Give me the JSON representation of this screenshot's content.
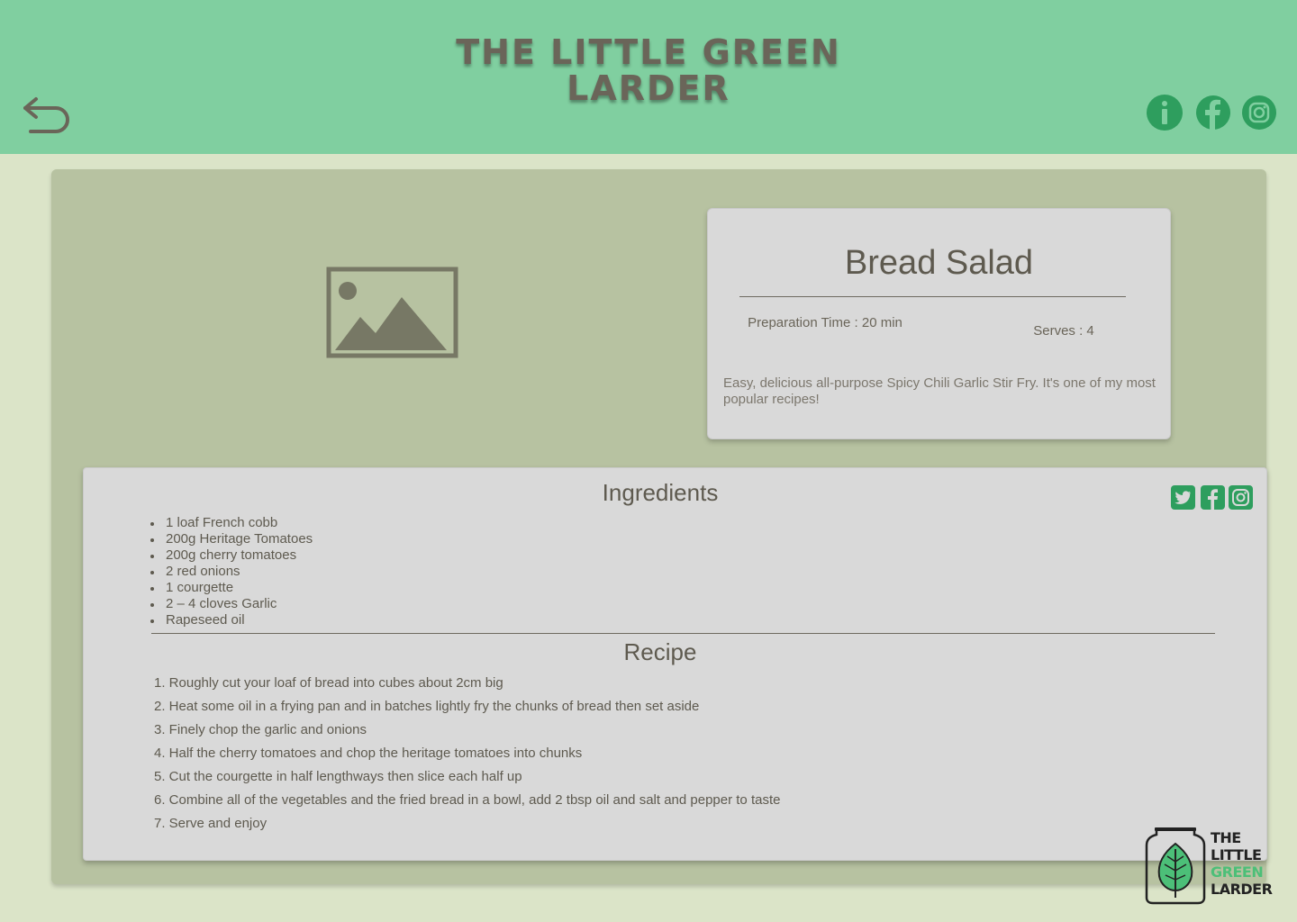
{
  "header": {
    "title_line1": "THE LITTLE GREEN",
    "title_line2": "LARDER",
    "icons": [
      "back-arrow-icon",
      "info-icon",
      "facebook-icon",
      "instagram-icon"
    ]
  },
  "recipe": {
    "title": "Bread Salad",
    "prep_label": "Preparation Time :  20 min",
    "serves_label": "Serves : 4",
    "description": "Easy, delicious all-purpose Spicy Chili Garlic Stir Fry. It's one of my most popular recipes!"
  },
  "ingredients": {
    "heading": "Ingredients",
    "items": [
      "1 loaf French cobb",
      "200g Heritage Tomatoes",
      "200g cherry tomatoes",
      "2 red onions",
      "1 courgette",
      "2 – 4 cloves Garlic",
      "Rapeseed oil"
    ]
  },
  "method": {
    "heading": "Recipe",
    "steps": [
      "1. Roughly cut your loaf of bread into cubes about 2cm big",
      "2. Heat some oil in a frying pan and in batches lightly fry the chunks of bread then set aside",
      "3. Finely chop the garlic and onions",
      "4. Half the cherry tomatoes and chop the heritage tomatoes into chunks",
      "5. Cut the courgette in half lengthways then slice each half up",
      "6. Combine all of the vegetables and the fried bread in a bowl, add 2 tbsp oil and salt and pepper to taste",
      "7. Serve and enjoy"
    ]
  },
  "share": {
    "icons": [
      "twitter-icon",
      "facebook-icon",
      "instagram-icon"
    ]
  },
  "brand": {
    "line1": "THE",
    "line2": "LITTLE",
    "line3": "GREEN",
    "line4": "LARDER"
  },
  "colors": {
    "header_bg": "#80cfa0",
    "page_bg": "#dbe4c8",
    "card_bg": "#b7c2a1",
    "panel_bg": "#d9d9d9",
    "accent_green": "#2e9e5e",
    "text": "#5e5a4f"
  }
}
